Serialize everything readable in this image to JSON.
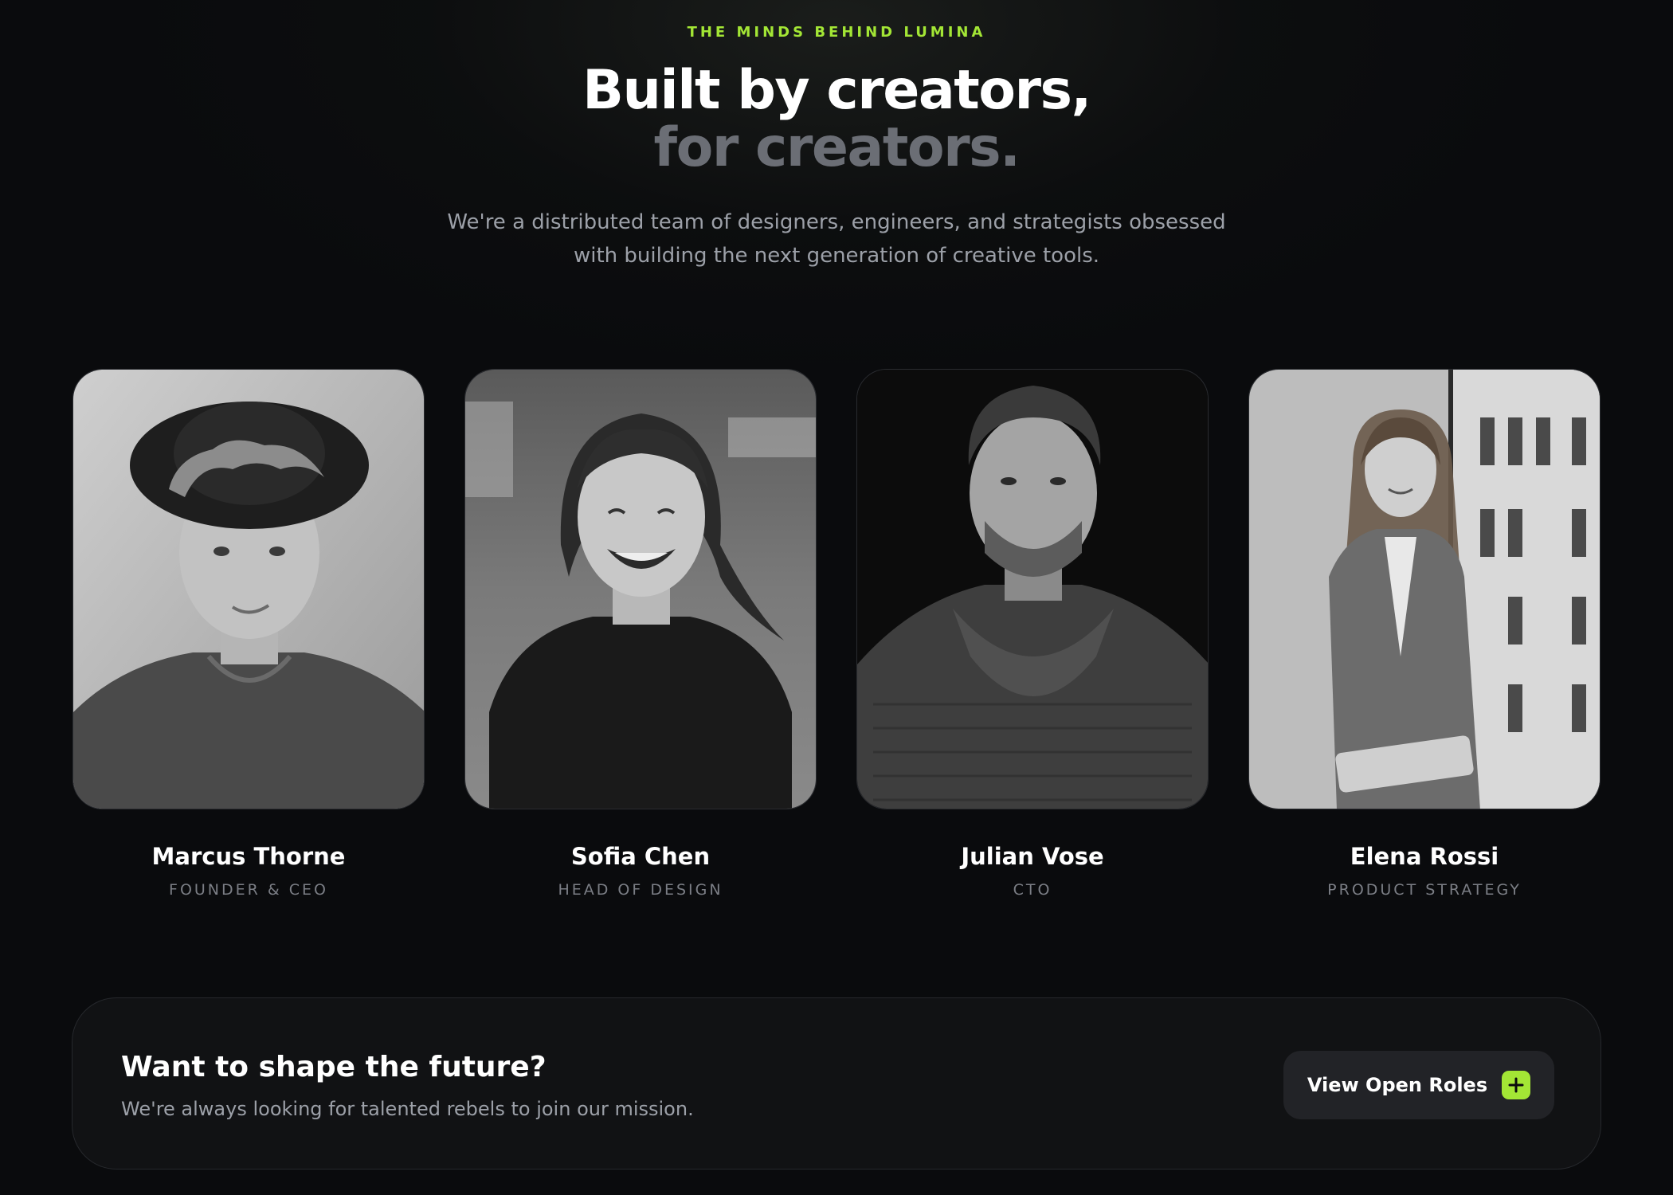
{
  "hero": {
    "eyebrow": "THE MINDS BEHIND LUMINA",
    "headline_line1": "Built by creators,",
    "headline_line2": "for creators.",
    "subtitle": "We're a distributed team of designers, engineers, and strategists obsessed with building the next generation of creative tools."
  },
  "team": [
    {
      "name": "Marcus Thorne",
      "role": "FOUNDER & CEO"
    },
    {
      "name": "Sofia Chen",
      "role": "HEAD OF DESIGN"
    },
    {
      "name": "Julian Vose",
      "role": "CTO"
    },
    {
      "name": "Elena Rossi",
      "role": "PRODUCT STRATEGY"
    }
  ],
  "cta": {
    "title": "Want to shape the future?",
    "subtitle": "We're always looking for talented rebels to join our mission.",
    "button_label": "View Open Roles",
    "button_icon": "plus-icon"
  },
  "colors": {
    "accent": "#a3e635",
    "background": "#0a0b0d",
    "muted_text": "#9ca0a8",
    "headline_muted": "#6b6e75"
  }
}
